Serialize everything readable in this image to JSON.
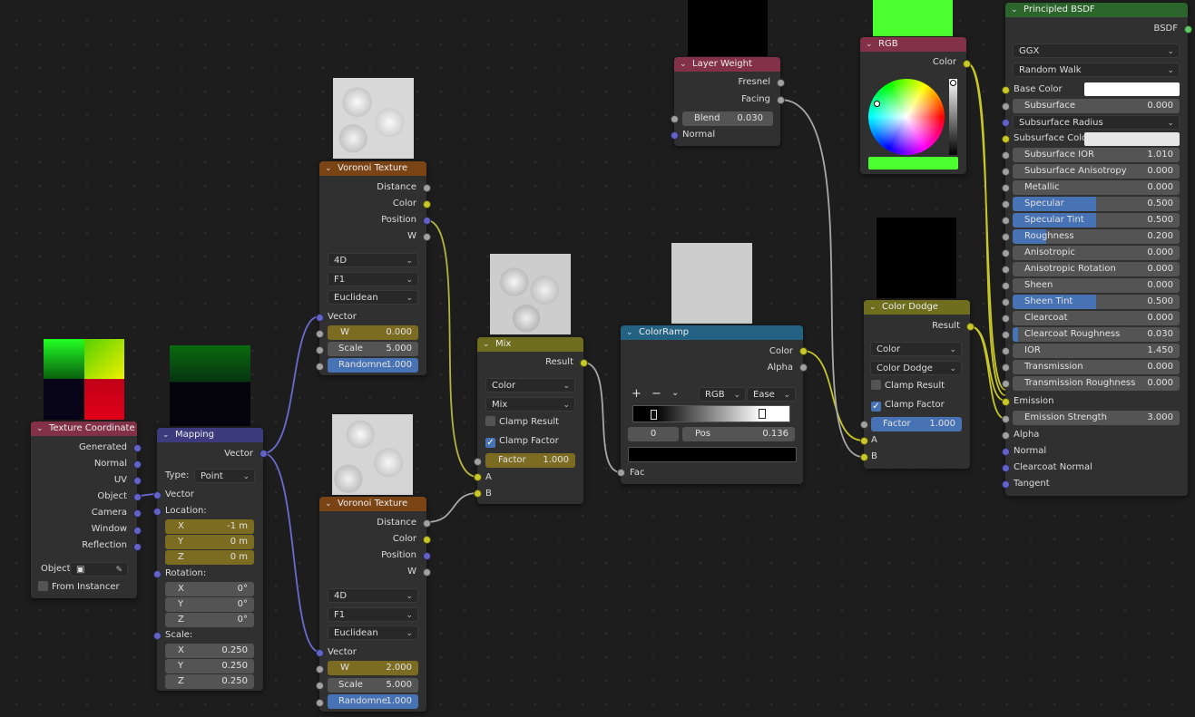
{
  "colors": {
    "input_header": "#83314a",
    "vector_header": "#3b3b7d",
    "texture_header": "#7a4415",
    "converter_header": "#246283",
    "shader_header": "#2b652b",
    "color_header": "#6e6e1e"
  },
  "tex_coord": {
    "title": "Texture Coordinate",
    "outputs": [
      "Generated",
      "Normal",
      "UV",
      "Object",
      "Camera",
      "Window",
      "Reflection"
    ],
    "object_label": "Object:",
    "from_instancer": "From Instancer"
  },
  "mapping": {
    "title": "Mapping",
    "out_vector": "Vector",
    "type_label": "Type:",
    "type_value": "Point",
    "in_vector": "Vector",
    "location_label": "Location:",
    "loc": {
      "x": "-1 m",
      "y": "0 m",
      "z": "0 m"
    },
    "rotation_label": "Rotation:",
    "rot": {
      "x": "0°",
      "y": "0°",
      "z": "0°"
    },
    "scale_label": "Scale:",
    "scale": {
      "x": "0.250",
      "y": "0.250",
      "z": "0.250"
    },
    "x": "X",
    "y": "Y",
    "z": "Z"
  },
  "voronoi1": {
    "title": "Voronoi Texture",
    "outputs": [
      "Distance",
      "Color",
      "Position",
      "W"
    ],
    "dim": "4D",
    "feature": "F1",
    "metric": "Euclidean",
    "in_vector": "Vector",
    "w_label": "W",
    "w": "0.000",
    "scale_label": "Scale",
    "scale": "5.000",
    "rand_label": "Randomne",
    "rand": "1.000"
  },
  "voronoi2": {
    "title": "Voronoi Texture",
    "outputs": [
      "Distance",
      "Color",
      "Position",
      "W"
    ],
    "dim": "4D",
    "feature": "F1",
    "metric": "Euclidean",
    "in_vector": "Vector",
    "w_label": "W",
    "w": "2.000",
    "scale_label": "Scale",
    "scale": "5.000",
    "rand_label": "Randomne",
    "rand": "1.000"
  },
  "mix": {
    "title": "Mix",
    "out": "Result",
    "type": "Color",
    "blend": "Mix",
    "clamp_result": "Clamp Result",
    "clamp_factor": "Clamp Factor",
    "factor_label": "Factor",
    "factor": "1.000",
    "in_a": "A",
    "in_b": "B"
  },
  "colorramp": {
    "title": "ColorRamp",
    "out_color": "Color",
    "out_alpha": "Alpha",
    "mode": "RGB",
    "interp": "Ease",
    "index": "0",
    "pos_label": "Pos",
    "pos": "0.136",
    "in_fac": "Fac"
  },
  "layerweight": {
    "title": "Layer Weight",
    "out_fresnel": "Fresnel",
    "out_facing": "Facing",
    "blend_label": "Blend",
    "blend": "0.030",
    "in_normal": "Normal"
  },
  "rgb": {
    "title": "RGB",
    "out_color": "Color",
    "swatch": "#4cff2e"
  },
  "colordodge": {
    "title": "Color Dodge",
    "out": "Result",
    "type": "Color",
    "blend": "Color Dodge",
    "clamp_result": "Clamp Result",
    "clamp_factor": "Clamp Factor",
    "factor_label": "Factor",
    "factor": "1.000",
    "in_a": "A",
    "in_b": "B"
  },
  "bsdf": {
    "title": "Principled BSDF",
    "out": "BSDF",
    "distribution": "GGX",
    "subsurface_method": "Random Walk",
    "base_color": "Base Color",
    "subsurface_radius": "Subsurface Radius",
    "subsurface_color": "Subsurface Color",
    "rows": [
      {
        "label": "Subsurface",
        "value": "0.000",
        "fill": 0
      },
      {
        "label": "Subsurface IOR",
        "value": "1.010",
        "fill": 0
      },
      {
        "label": "Subsurface Anisotropy",
        "value": "0.000",
        "fill": 0
      },
      {
        "label": "Metallic",
        "value": "0.000",
        "fill": 0
      },
      {
        "label": "Specular",
        "value": "0.500",
        "fill": 0.5
      },
      {
        "label": "Specular Tint",
        "value": "0.500",
        "fill": 0.5
      },
      {
        "label": "Roughness",
        "value": "0.200",
        "fill": 0.2
      },
      {
        "label": "Anisotropic",
        "value": "0.000",
        "fill": 0
      },
      {
        "label": "Anisotropic Rotation",
        "value": "0.000",
        "fill": 0
      },
      {
        "label": "Sheen",
        "value": "0.000",
        "fill": 0
      },
      {
        "label": "Sheen Tint",
        "value": "0.500",
        "fill": 0.5
      },
      {
        "label": "Clearcoat",
        "value": "0.000",
        "fill": 0
      },
      {
        "label": "Clearcoat Roughness",
        "value": "0.030",
        "fill": 0.03
      },
      {
        "label": "IOR",
        "value": "1.450",
        "fill": 0
      },
      {
        "label": "Transmission",
        "value": "0.000",
        "fill": 0
      },
      {
        "label": "Transmission Roughness",
        "value": "0.000",
        "fill": 0
      }
    ],
    "emission": "Emission",
    "emission_strength_label": "Emission Strength",
    "emission_strength": "3.000",
    "alpha": "Alpha",
    "normal": "Normal",
    "clearcoat_normal": "Clearcoat Normal",
    "tangent": "Tangent"
  }
}
